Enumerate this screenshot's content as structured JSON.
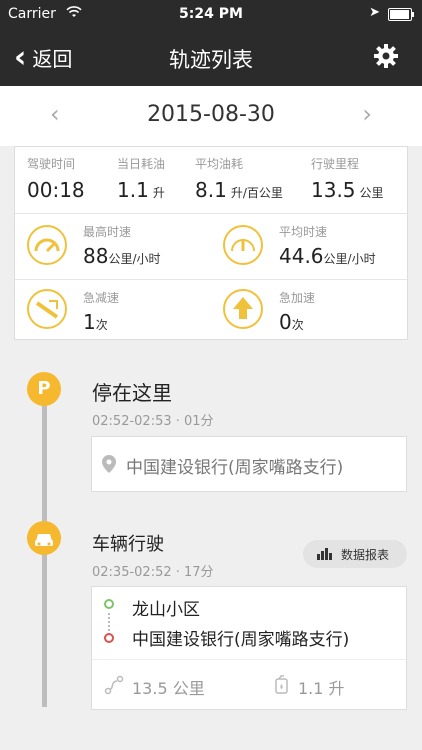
{
  "status_bar": {
    "carrier": "Carrier",
    "time": "5:24 PM"
  },
  "nav": {
    "back_label": "返回",
    "title": "轨迹列表"
  },
  "date_nav": {
    "date": "2015-08-30",
    "prev": "‹",
    "next": "›"
  },
  "summary": {
    "top": [
      {
        "label": "驾驶时间",
        "value": "00:18",
        "unit": ""
      },
      {
        "label": "当日耗油",
        "value": "1.1",
        "unit": "升"
      },
      {
        "label": "平均油耗",
        "value": "8.1",
        "unit": "升/百公里"
      },
      {
        "label": "行驶里程",
        "value": "13.5",
        "unit": "公里"
      }
    ],
    "max_speed": {
      "label": "最高时速",
      "value": "88",
      "unit": "公里/小时"
    },
    "avg_speed": {
      "label": "平均时速",
      "value": "44.6",
      "unit": "公里/小时"
    },
    "hard_brake": {
      "label": "急减速",
      "value": "1",
      "unit": "次"
    },
    "hard_accel": {
      "label": "急加速",
      "value": "0",
      "unit": "次"
    }
  },
  "stop": {
    "icon_letter": "P",
    "title": "停在这里",
    "time": "02:52-02:53 · 01分",
    "address": "中国建设银行(周家嘴路支行)"
  },
  "drive": {
    "title": "车辆行驶",
    "time": "02:35-02:52 · 17分",
    "report_label": "数据报表",
    "from": "龙山小区",
    "to": "中国建设银行(周家嘴路支行)",
    "distance": "13.5 公里",
    "fuel": "1.1 升"
  },
  "colors": {
    "accent": "#f5b82e",
    "nav_bg": "#2b2b2b",
    "from_dot": "#7cc36b",
    "to_dot": "#d9534f"
  }
}
